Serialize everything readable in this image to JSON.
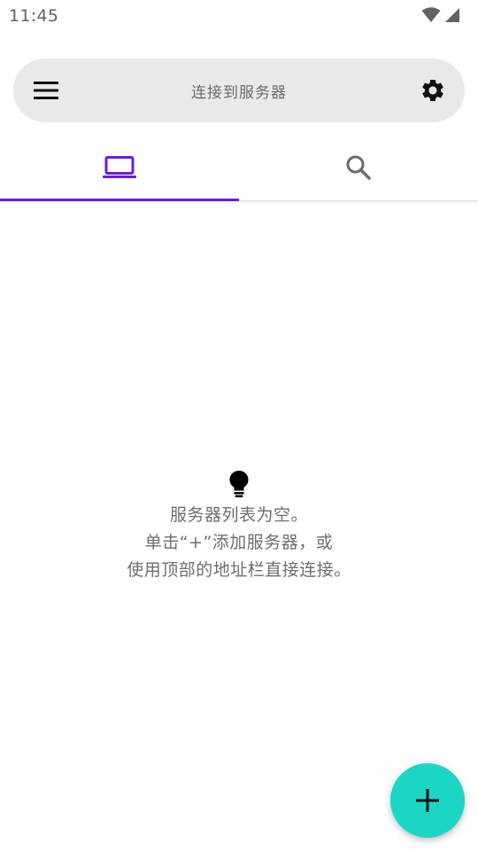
{
  "status_bar": {
    "time": "11:45",
    "icons": [
      "wifi-icon",
      "cellular-signal-icon"
    ]
  },
  "search_bar": {
    "placeholder": "连接到服务器",
    "left_icon": "menu-icon",
    "right_icon": "settings-gear-icon"
  },
  "tabs": [
    {
      "icon": "laptop-icon",
      "selected": true
    },
    {
      "icon": "search-icon",
      "selected": false
    }
  ],
  "colors": {
    "accent": "#6a1be0",
    "fab": "#1cd6c5",
    "search_bg": "#e9e9e9",
    "text_muted": "#6e6e6e"
  },
  "empty_state": {
    "icon": "lightbulb-icon",
    "line1": "服务器列表为空。",
    "line2": "单击“+”添加服务器，或",
    "line3": "使用顶部的地址栏直接连接。"
  },
  "fab": {
    "icon": "add-icon"
  }
}
